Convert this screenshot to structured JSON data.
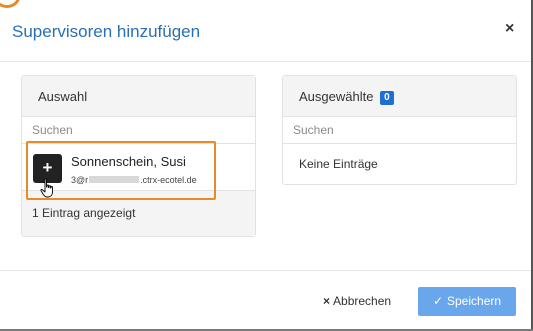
{
  "dialog": {
    "title": "Supervisoren hinzufügen",
    "close_icon": "×"
  },
  "left_panel": {
    "header": "Auswahl",
    "search_placeholder": "Suchen",
    "items": [
      {
        "name": "Sonnenschein, Susi",
        "email_prefix": "3@r",
        "email_suffix": ".ctrx-ecotel.de",
        "add_icon": "+"
      }
    ],
    "footer": "1 Eintrag angezeigt"
  },
  "right_panel": {
    "header": "Ausgewählte",
    "count": "0",
    "search_placeholder": "Suchen",
    "empty_text": "Keine Einträge"
  },
  "footer": {
    "cancel_icon": "×",
    "cancel_label": "Abbrechen",
    "save_icon": "✓",
    "save_label": "Speichern"
  },
  "colors": {
    "title": "#2a6fb4",
    "badge": "#1f6fd0",
    "save_button": "#6aa6ec",
    "highlight": "#e8892c"
  }
}
